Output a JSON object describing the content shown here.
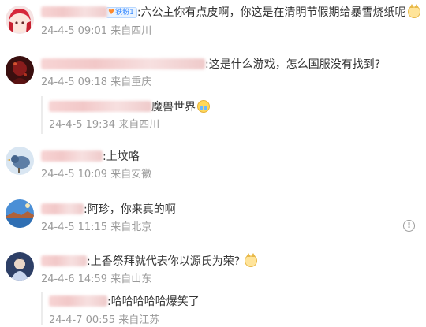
{
  "comments": [
    {
      "badge_label": "铁粉1",
      "text": ":六公主你有点皮啊，你这是在清明节假期给暴雪烧纸呢",
      "date": "24-4-5 09:01",
      "location": "来自四川"
    },
    {
      "text": ":这是什么游戏，怎么国服没有找到?",
      "date": "24-4-5 09:18",
      "location": "来自重庆",
      "reply": {
        "text": "魔兽世界",
        "date": "24-4-5 19:34",
        "location": "来自四川"
      }
    },
    {
      "text": ":上坟咯",
      "date": "24-4-5 10:09",
      "location": "来自安徽"
    },
    {
      "text": ":阿珍，你来真的啊",
      "date": "24-4-5 11:15",
      "location": "来自北京"
    },
    {
      "text": ":上香祭拜就代表你以源氏为荣?",
      "date": "24-4-6 14:59",
      "location": "来自山东",
      "reply": {
        "text": ":哈哈哈哈哈爆笑了",
        "date": "24-4-7 00:55",
        "location": "来自江苏"
      }
    }
  ],
  "icons": {
    "emoji_cat": "cat-face-emoji",
    "emoji_cry": "crying-face-emoji",
    "info": "info-icon"
  }
}
